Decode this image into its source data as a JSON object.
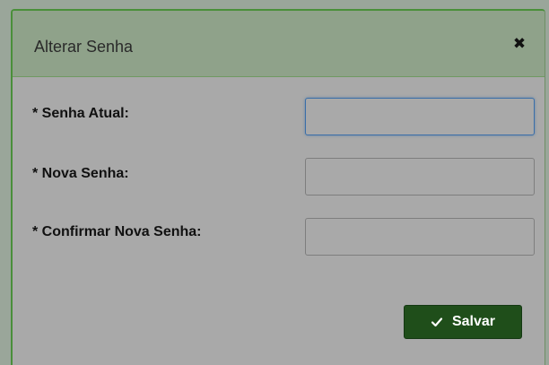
{
  "dialog": {
    "title": "Alterar Senha",
    "close_icon": "close-icon"
  },
  "form": {
    "fields": [
      {
        "label": "* Senha Atual:",
        "value": "",
        "placeholder": ""
      },
      {
        "label": "* Nova Senha:",
        "value": "",
        "placeholder": ""
      },
      {
        "label": "* Confirmar Nova Senha:",
        "value": "",
        "placeholder": ""
      }
    ]
  },
  "actions": {
    "save_label": "Salvar",
    "save_icon": "check-icon"
  },
  "colors": {
    "header_bg": "#8fa28a",
    "body_bg": "#a9a9a9",
    "accent_border": "#4a8f3a",
    "focus_border": "#3a6ea8",
    "save_button_bg": "#1f4e1a"
  }
}
